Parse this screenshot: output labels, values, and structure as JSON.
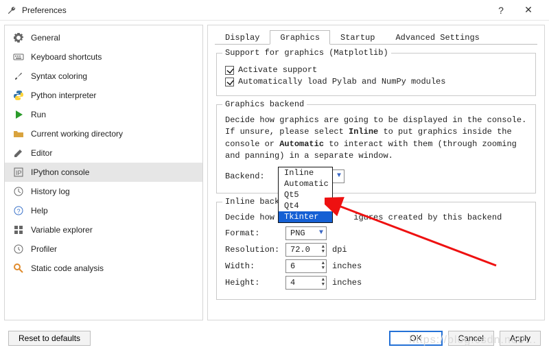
{
  "window": {
    "title": "Preferences"
  },
  "sidebar": {
    "items": [
      {
        "label": "General",
        "icon": "gear-icon"
      },
      {
        "label": "Keyboard shortcuts",
        "icon": "keyboard-icon"
      },
      {
        "label": "Syntax coloring",
        "icon": "brush-icon"
      },
      {
        "label": "Python interpreter",
        "icon": "python-icon"
      },
      {
        "label": "Run",
        "icon": "play-icon"
      },
      {
        "label": "Current working directory",
        "icon": "folder-icon"
      },
      {
        "label": "Editor",
        "icon": "edit-icon"
      },
      {
        "label": "IPython console",
        "icon": "ipython-icon",
        "selected": true
      },
      {
        "label": "History log",
        "icon": "history-icon"
      },
      {
        "label": "Help",
        "icon": "help-icon"
      },
      {
        "label": "Variable explorer",
        "icon": "grid-icon"
      },
      {
        "label": "Profiler",
        "icon": "clock-icon"
      },
      {
        "label": "Static code analysis",
        "icon": "search-icon"
      }
    ]
  },
  "tabs": {
    "items": [
      {
        "label": "Display"
      },
      {
        "label": "Graphics",
        "active": true
      },
      {
        "label": "Startup"
      },
      {
        "label": "Advanced Settings"
      }
    ]
  },
  "support_group": {
    "legend": "Support for graphics (Matplotlib)",
    "activate": "Activate support",
    "autoload": "Automatically load Pylab and NumPy modules"
  },
  "backend_group": {
    "legend": "Graphics backend",
    "desc_pre": "Decide how graphics are going to be displayed in the console. If unsure, please select ",
    "desc_inline": "Inline",
    "desc_mid": " to put graphics inside the console or ",
    "desc_auto": "Automatic",
    "desc_post": " to interact with them (through zooming and panning) in a separate window.",
    "backend_label": "Backend:",
    "backend_value": "Tkinter",
    "options": [
      "Inline",
      "Automatic",
      "Qt5",
      "Qt4",
      "Tkinter"
    ]
  },
  "inline_group": {
    "legend_partial": "Inline back",
    "desc_pre": "Decide how t",
    "desc_post": "igures created by this backend",
    "format_label": "Format:",
    "format_value": "PNG",
    "resolution_label": "Resolution:",
    "resolution_value": "72.0",
    "resolution_unit": "dpi",
    "width_label": "Width:",
    "width_value": "6",
    "width_unit": "inches",
    "height_label": "Height:",
    "height_value": "4",
    "height_unit": "inches"
  },
  "footer": {
    "reset": "Reset to defaults",
    "ok": "OK",
    "cancel": "Cancel",
    "apply": "Apply"
  }
}
